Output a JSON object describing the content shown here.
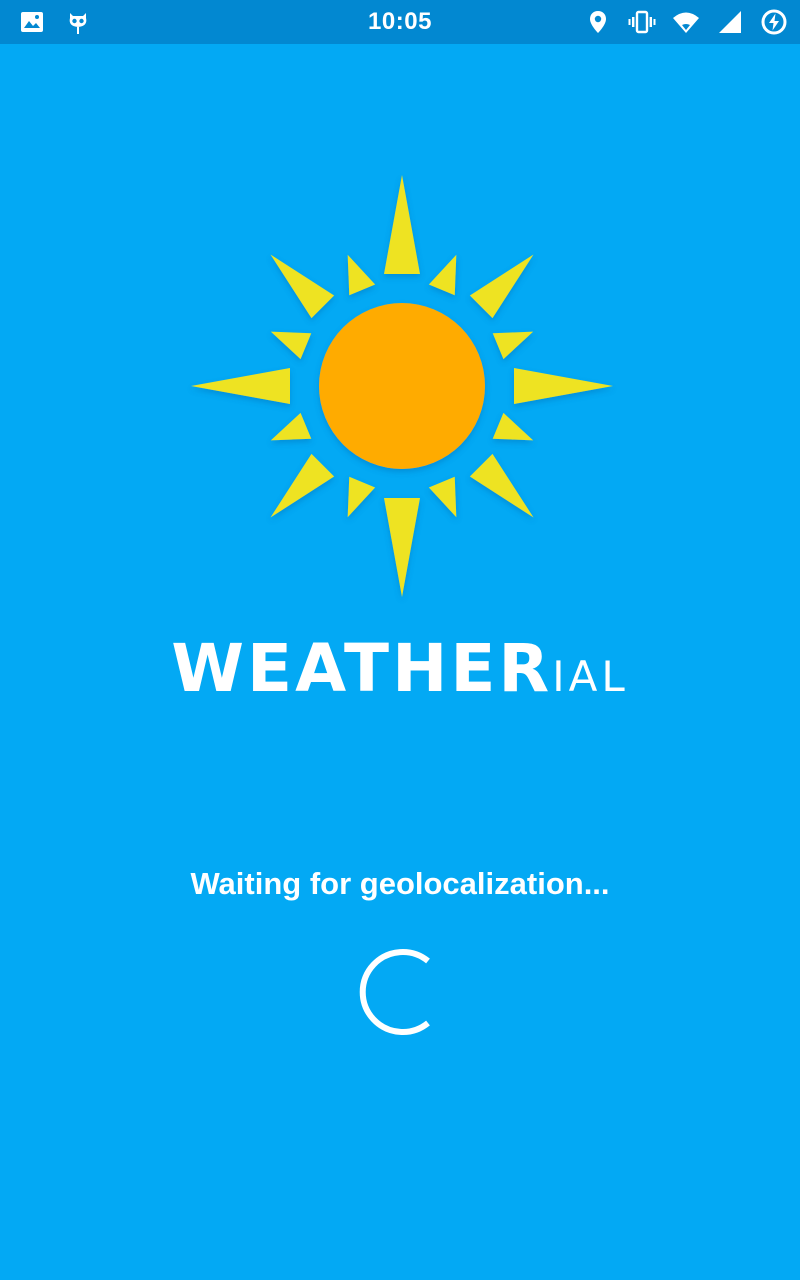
{
  "status_bar": {
    "time": "10:05",
    "left_icons": [
      "image-icon",
      "cyanogen-mascot-icon"
    ],
    "right_icons": [
      "location-pin-icon",
      "vibrate-icon",
      "wifi-icon",
      "cell-signal-icon",
      "battery-charging-icon"
    ]
  },
  "app": {
    "logo_main": "WEATHER",
    "logo_suffix": "IAL"
  },
  "loading": {
    "message": "Waiting for geolocalization..."
  },
  "colors": {
    "background": "#03a9f4",
    "status_bar": "#0288d1",
    "sun_core": "#ffab00",
    "sun_rays": "#eee323",
    "text": "#ffffff"
  }
}
